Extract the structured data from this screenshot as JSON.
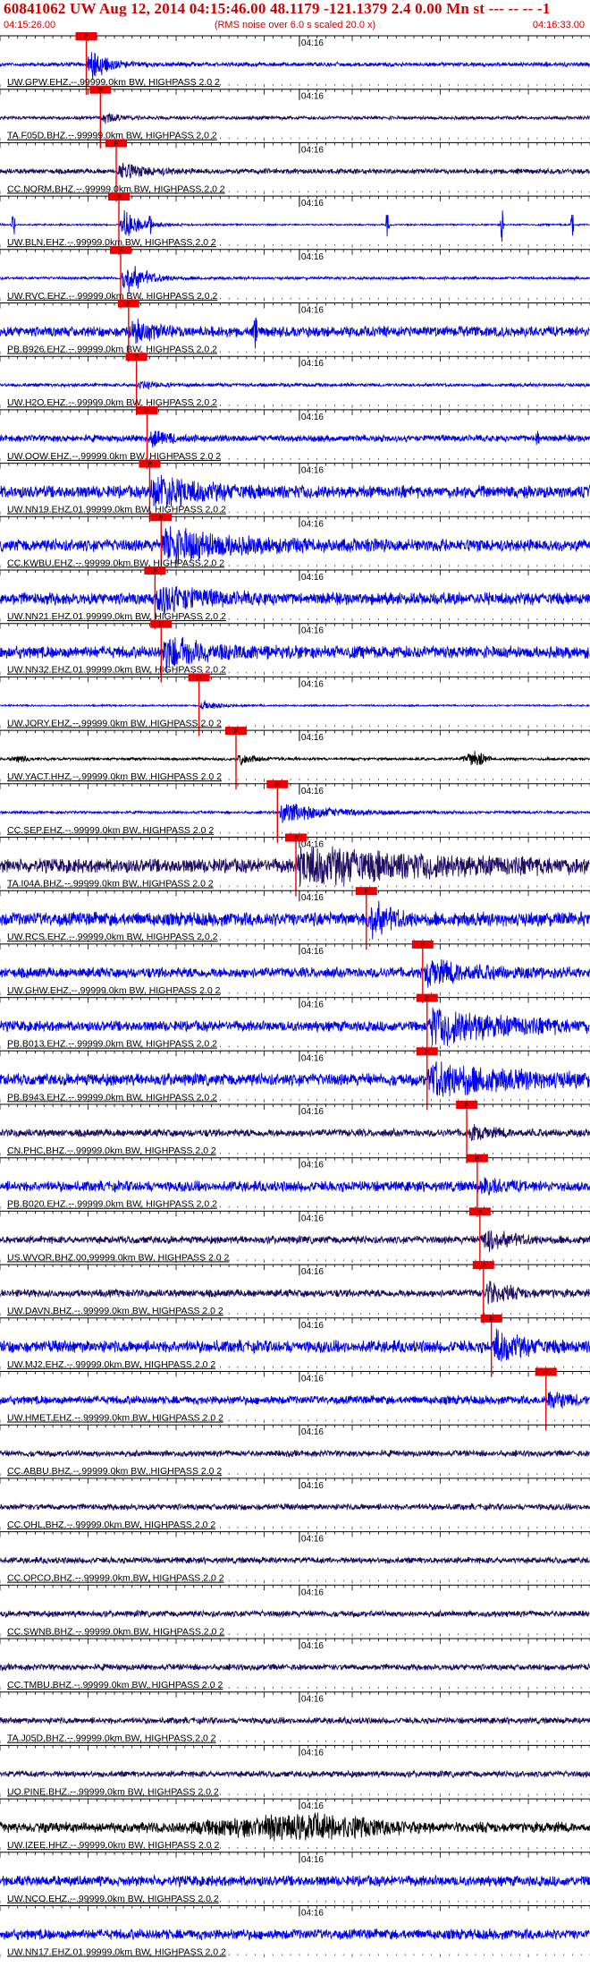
{
  "header": {
    "title": "60841062 UW Aug 12, 2014 04:15:46.00   48.1179 -121.1379  2.4 0.00 Mn st --- -- --   -1",
    "start_time": "04:15:26.00",
    "note": "(RMS noise over 6.0 s scaled 20.0 x)",
    "end_time": "04:16:33.00"
  },
  "chart_data": {
    "type": "line",
    "title": "60841062 UW Aug 12, 2014 04:15:46.00   48.1179 -121.1379  2.4 0.00 Mn st --- -- --   -1",
    "x_range": [
      "04:15:26.00",
      "04:16:33.00"
    ],
    "x_range_seconds": [
      0,
      67
    ],
    "mid_tick_label": "04:16",
    "mid_tick_seconds": 34,
    "pick_label": "P",
    "colors": {
      "blue": "#0000ee",
      "navy": "#1c0a63",
      "black": "#000000",
      "pick": "#ee0000"
    },
    "series": [
      {
        "label": "UW.GPW.EHZ.--.99999.0km BW, HIGHPASS  2.0  2",
        "color": "blue",
        "pick": 9.8,
        "amp": 0.9,
        "noise": 0.12,
        "dur": 4
      },
      {
        "label": "TA.F05D.BHZ.--.99999.0km BW, HIGHPASS  2.0  2",
        "color": "navy",
        "pick": 11.4,
        "amp": 0.25,
        "noise": 0.1,
        "dur": 4
      },
      {
        "label": "CC.NORM.BHZ.--.99999.0km BW, HIGHPASS  2.0  2",
        "color": "navy",
        "pick": 13.2,
        "amp": 0.45,
        "noise": 0.15,
        "dur": 6
      },
      {
        "label": "UW.BLN.EHZ.--.99999.0km BW, HIGHPASS  2.0  2",
        "color": "blue",
        "pick": 13.5,
        "amp": 0.8,
        "noise": 0.05,
        "dur": 4,
        "spikes": [
          1.5,
          17,
          44,
          57,
          65
        ]
      },
      {
        "label": "UW.RVC.EHZ.--.99999.0km BW, HIGHPASS  2.0  2",
        "color": "blue",
        "pick": 13.7,
        "amp": 0.95,
        "noise": 0.08,
        "dur": 5
      },
      {
        "label": "PB.B926.EHZ.--.99999.0km BW, HIGHPASS  2.0  2",
        "color": "blue",
        "pick": 14.6,
        "amp": 0.6,
        "noise": 0.3,
        "dur": 5,
        "spikes": [
          29
        ]
      },
      {
        "label": "UW.H2O.EHZ.--.99999.0km BW, HIGHPASS  2.0  2",
        "color": "blue",
        "pick": 15.5,
        "amp": 0.2,
        "noise": 0.1,
        "dur": 4
      },
      {
        "label": "UW.OOW.EHZ.--.99999.0km BW, HIGHPASS  2.0  2",
        "color": "blue",
        "pick": 16.7,
        "amp": 0.4,
        "noise": 0.2,
        "dur": 4,
        "spikes": [
          61
        ]
      },
      {
        "label": "UW.NN19.EHZ.01.99999.0km BW, HIGHPASS  2.0  2",
        "color": "blue",
        "pick": 17.0,
        "amp": 0.95,
        "noise": 0.35,
        "dur": 10
      },
      {
        "label": "CC.KWBU.EHZ.--.99999.0km BW, HIGHPASS  2.0  2",
        "color": "blue",
        "pick": 18.3,
        "amp": 0.98,
        "noise": 0.35,
        "dur": 14
      },
      {
        "label": "UW.NN21.EHZ.01.99999.0km BW, HIGHPASS  2.0  2",
        "color": "blue",
        "pick": 17.6,
        "amp": 0.8,
        "noise": 0.35,
        "dur": 10
      },
      {
        "label": "UW.NN32.EHZ.01.99999.0km BW, HIGHPASS  2.0  2",
        "color": "blue",
        "pick": 18.3,
        "amp": 0.8,
        "noise": 0.35,
        "dur": 10
      },
      {
        "label": "UW.JORY.EHZ.--.99999.0km BW, HIGHPASS  2.0  2",
        "color": "blue",
        "pick": 22.6,
        "amp": 0.25,
        "noise": 0.05,
        "dur": 4
      },
      {
        "label": "UW.YACT.HHZ.--.99999.0km BW, HIGHPASS  2.0  2",
        "color": "black",
        "pick": 26.8,
        "amp": 0.3,
        "noise": 0.08,
        "dur": 4,
        "bursts": [
          [
            1,
            3,
            0.2
          ],
          [
            52,
            4,
            0.45
          ]
        ]
      },
      {
        "label": "CC.SEP.EHZ.--.99999.0km BW, HIGHPASS  2.0  2",
        "color": "blue",
        "pick": 31.5,
        "amp": 0.6,
        "noise": 0.08,
        "dur": 12
      },
      {
        "label": "TA.I04A.BHZ.--.99999.0km BW, HIGHPASS  2.0  2",
        "color": "navy",
        "pick": 33.6,
        "amp": 0.95,
        "noise": 0.4,
        "dur": 32
      },
      {
        "label": "UW.RCS.EHZ.--.99999.0km BW, HIGHPASS  2.0  2",
        "color": "blue",
        "pick": 41.6,
        "amp": 0.9,
        "noise": 0.4,
        "dur": 5
      },
      {
        "label": "UW.GHW.EHZ.--.99999.0km BW, HIGHPASS  2.0  2",
        "color": "blue",
        "pick": 48.0,
        "amp": 0.6,
        "noise": 0.3,
        "dur": 12
      },
      {
        "label": "PB.B013.EHZ.--.99999.0km BW, HIGHPASS  2.0  2",
        "color": "blue",
        "pick": 48.5,
        "amp": 1.0,
        "noise": 0.3,
        "dur": 18
      },
      {
        "label": "PB.B943.EHZ.--.99999.0km BW, HIGHPASS  2.0  2",
        "color": "blue",
        "pick": 48.5,
        "amp": 1.0,
        "noise": 0.35,
        "dur": 18
      },
      {
        "label": "CN.PHC.BHZ.--.99999.0km BW, HIGHPASS  2.0  2",
        "color": "navy",
        "pick": 53.0,
        "amp": 0.3,
        "noise": 0.22,
        "dur": 6
      },
      {
        "label": "PB.B020.EHZ.--.99999.0km BW, HIGHPASS  2.0  2",
        "color": "blue",
        "pick": 54.2,
        "amp": 0.35,
        "noise": 0.3,
        "dur": 6
      },
      {
        "label": "US.WVOR.BHZ.00.99999.0km BW, HIGHPASS  2.0  2",
        "color": "navy",
        "pick": 54.5,
        "amp": 0.55,
        "noise": 0.22,
        "dur": 7
      },
      {
        "label": "UW.DAVN.BHZ.--.99999.0km BW, HIGHPASS  2.0  2",
        "color": "navy",
        "pick": 54.9,
        "amp": 0.55,
        "noise": 0.22,
        "dur": 6
      },
      {
        "label": "UW.MJ2.EHZ.--.99999.0km BW, HIGHPASS  2.0  2",
        "color": "blue",
        "pick": 55.8,
        "amp": 0.8,
        "noise": 0.35,
        "dur": 6
      },
      {
        "label": "UW.HMET.EHZ.--.99999.0km BW, HIGHPASS  2.0  2",
        "color": "blue",
        "pick": 62.0,
        "amp": 0.5,
        "noise": 0.25,
        "dur": 4
      },
      {
        "label": "CC.ABBU.BHZ.--.99999.0km BW, HIGHPASS  2.0  2",
        "color": "navy",
        "pick": null,
        "amp": 0,
        "noise": 0.18,
        "dur": 0
      },
      {
        "label": "CC.OHL.BHZ.--.99999.0km BW, HIGHPASS  2.0  2",
        "color": "navy",
        "pick": null,
        "amp": 0,
        "noise": 0.18,
        "dur": 0
      },
      {
        "label": "CC.OPCO.BHZ.--.99999.0km BW, HIGHPASS  2.0  2",
        "color": "navy",
        "pick": null,
        "amp": 0,
        "noise": 0.18,
        "dur": 0
      },
      {
        "label": "CC.SWNB.BHZ.--.99999.0km BW, HIGHPASS  2.0  2",
        "color": "navy",
        "pick": null,
        "amp": 0,
        "noise": 0.18,
        "dur": 0
      },
      {
        "label": "CC.TMBU.BHZ.--.99999.0km BW, HIGHPASS  2.0  2",
        "color": "navy",
        "pick": null,
        "amp": 0,
        "noise": 0.18,
        "dur": 0
      },
      {
        "label": "TA.J05D.BHZ.--.99999.0km BW, HIGHPASS  2.0  2",
        "color": "navy",
        "pick": null,
        "amp": 0,
        "noise": 0.18,
        "dur": 0
      },
      {
        "label": "UO.PINE.BHZ.--.99999.0km BW, HIGHPASS  2.0  2",
        "color": "navy",
        "pick": null,
        "amp": 0,
        "noise": 0.18,
        "dur": 0
      },
      {
        "label": "UW.IZEE.HHZ.--.99999.0km BW, HIGHPASS  2.0  2",
        "color": "black",
        "pick": null,
        "amp": 0,
        "noise": 0.3,
        "dur": 0,
        "bursts": [
          [
            20,
            30,
            0.6
          ]
        ]
      },
      {
        "label": "UW.NCO.EHZ.--.99999.0km BW, HIGHPASS  2.0  2",
        "color": "blue",
        "pick": null,
        "amp": 0,
        "noise": 0.3,
        "dur": 0
      },
      {
        "label": "UW.NN17.EHZ.01.99999.0km BW, HIGHPASS  2.0  2",
        "color": "blue",
        "pick": null,
        "amp": 0,
        "noise": 0.3,
        "dur": 0
      }
    ]
  }
}
